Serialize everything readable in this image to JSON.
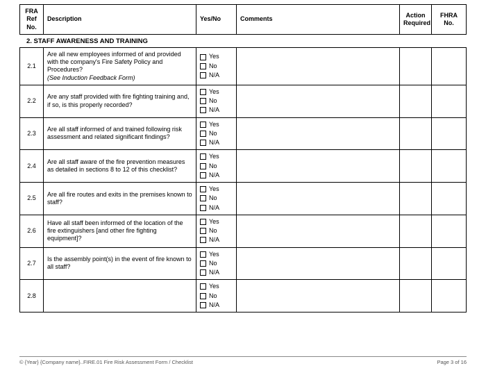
{
  "headers": {
    "ref": "FRA Ref No.",
    "desc": "Description",
    "yn": "Yes/No",
    "comments": "Comments",
    "action": "Action Required",
    "fhra": "FHRA No."
  },
  "section_title": "2. STAFF AWARENESS AND TRAINING",
  "yn_labels": {
    "yes": "Yes",
    "no": "No",
    "na": "N/A"
  },
  "rows": [
    {
      "ref": "2.1",
      "desc": "Are all new employees informed of and provided with the company's Fire Safety Policy and Procedures?",
      "desc_sub": "(See Induction Feedback Form)"
    },
    {
      "ref": "2.2",
      "desc": "Are any staff provided with fire fighting training and, if so, is this properly recorded?",
      "desc_sub": ""
    },
    {
      "ref": "2.3",
      "desc": "Are all staff informed of and trained following risk assessment and related significant findings?",
      "desc_sub": ""
    },
    {
      "ref": "2.4",
      "desc": "Are all staff aware of the fire prevention measures as detailed in sections 8 to 12 of this checklist?",
      "desc_sub": ""
    },
    {
      "ref": "2.5",
      "desc": "Are all fire routes and exits in the premises known to staff?",
      "desc_sub": ""
    },
    {
      "ref": "2.6",
      "desc": "Have all staff been informed of the location of the fire extinguishers [and other fire fighting equipment]?",
      "desc_sub": ""
    },
    {
      "ref": "2.7",
      "desc": "Is the assembly point(s) in the event of fire known to all staff?",
      "desc_sub": ""
    },
    {
      "ref": "2.8",
      "desc": "",
      "desc_sub": ""
    }
  ],
  "footer": {
    "left": "© {Year} {Company name}..FIRE.01 Fire Risk Assessment Form /  Checklist",
    "right": "Page 3 of 16"
  }
}
